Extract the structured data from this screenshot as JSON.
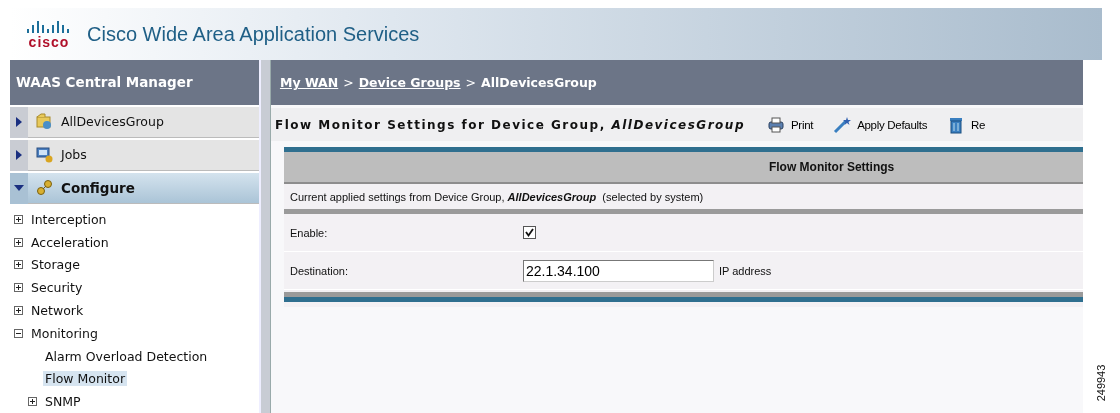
{
  "header": {
    "logo_text": "cisco",
    "title": "Cisco Wide Area Application Services"
  },
  "sidebar": {
    "title": "WAAS Central Manager",
    "nav": [
      {
        "label": "AllDevicesGroup",
        "kind": "group",
        "expanded": false
      },
      {
        "label": "Jobs",
        "kind": "jobs",
        "expanded": false
      },
      {
        "label": "Configure",
        "kind": "configure",
        "expanded": true
      }
    ],
    "tree": [
      {
        "label": "Interception",
        "expanded": false,
        "selected": false
      },
      {
        "label": "Acceleration",
        "expanded": false,
        "selected": false
      },
      {
        "label": "Storage",
        "expanded": false,
        "selected": false
      },
      {
        "label": "Security",
        "expanded": false,
        "selected": false
      },
      {
        "label": "Network",
        "expanded": false,
        "selected": false
      },
      {
        "label": "Monitoring",
        "expanded": true,
        "selected": false,
        "children": [
          {
            "label": "Alarm Overload Detection",
            "selected": false
          },
          {
            "label": "Flow Monitor",
            "selected": true
          },
          {
            "label": "SNMP",
            "expanded": false,
            "selected": false
          }
        ]
      }
    ]
  },
  "breadcrumb": {
    "separator": ">",
    "items": [
      {
        "label": "My WAN",
        "link": true
      },
      {
        "label": "Device Groups",
        "link": true
      },
      {
        "label": "AllDevicesGroup",
        "link": false
      }
    ]
  },
  "toolbar": {
    "title": "Flow Monitor Settings for Device Group, *AllDevicesGroup*",
    "buttons": [
      {
        "label": "Print",
        "kind": "print"
      },
      {
        "label": "Apply Defaults",
        "kind": "defaults"
      },
      {
        "label": "Re",
        "kind": "remove"
      }
    ]
  },
  "panel": {
    "title": "Flow Monitor Settings",
    "note": "Current applied settings from Device Group, **AllDevicesGroup**  (selected by system)",
    "fields": [
      {
        "label": "Enable:",
        "kind": "checkbox",
        "checked": true
      },
      {
        "label": "Destination:",
        "kind": "text",
        "value": "22.1.34.100",
        "hint": "IP address"
      }
    ]
  },
  "figure_number": "249943"
}
